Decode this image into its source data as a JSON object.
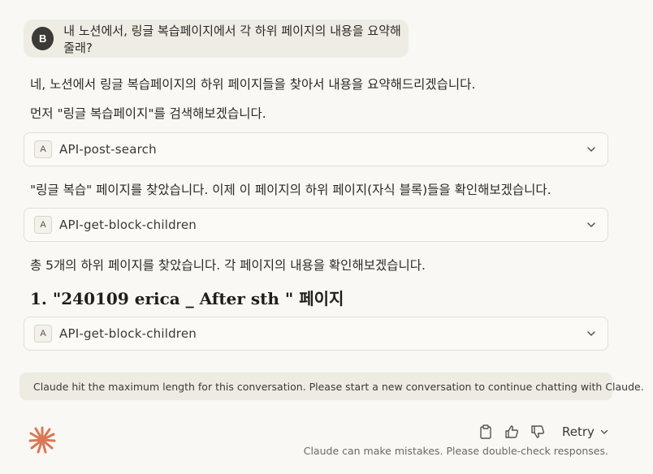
{
  "user_message": {
    "avatar_initial": "B",
    "text": "내 노션에서, 링글 복습페이지에서 각 하위 페이지의 내용을 요약해줄래?"
  },
  "assistant": {
    "para1": "네, 노션에서 링글 복습페이지의 하위 페이지들을 찾아서 내용을 요약해드리겠습니다.",
    "para2": "먼저 \"링글 복습페이지\"를 검색해보겠습니다.",
    "tool1": {
      "badge": "A",
      "name": "API-post-search"
    },
    "para3": "\"링글 복습\" 페이지를 찾았습니다. 이제 이 페이지의 하위 페이지(자식 블록)들을 확인해보겠습니다.",
    "tool2": {
      "badge": "A",
      "name": "API-get-block-children"
    },
    "para4": "총 5개의 하위 페이지를 찾았습니다. 각 페이지의 내용을 확인해보겠습니다.",
    "heading": "1. \"240109 erica _ After sth \" 페이지",
    "tool3": {
      "badge": "A",
      "name": "API-get-block-children"
    }
  },
  "limit_notice": {
    "icon": "info-icon",
    "text": "Claude hit the maximum length for this conversation. Please start a new conversation to continue chatting with Claude."
  },
  "footer": {
    "retry_label": "Retry",
    "disclaimer": "Claude can make mistakes. Please double-check responses.",
    "icons": [
      "clipboard-icon",
      "thumbs-up-icon",
      "thumbs-down-icon"
    ]
  },
  "colors": {
    "background": "#faf8f4",
    "user_bubble": "#efece4",
    "brand_orange": "#d97757"
  }
}
